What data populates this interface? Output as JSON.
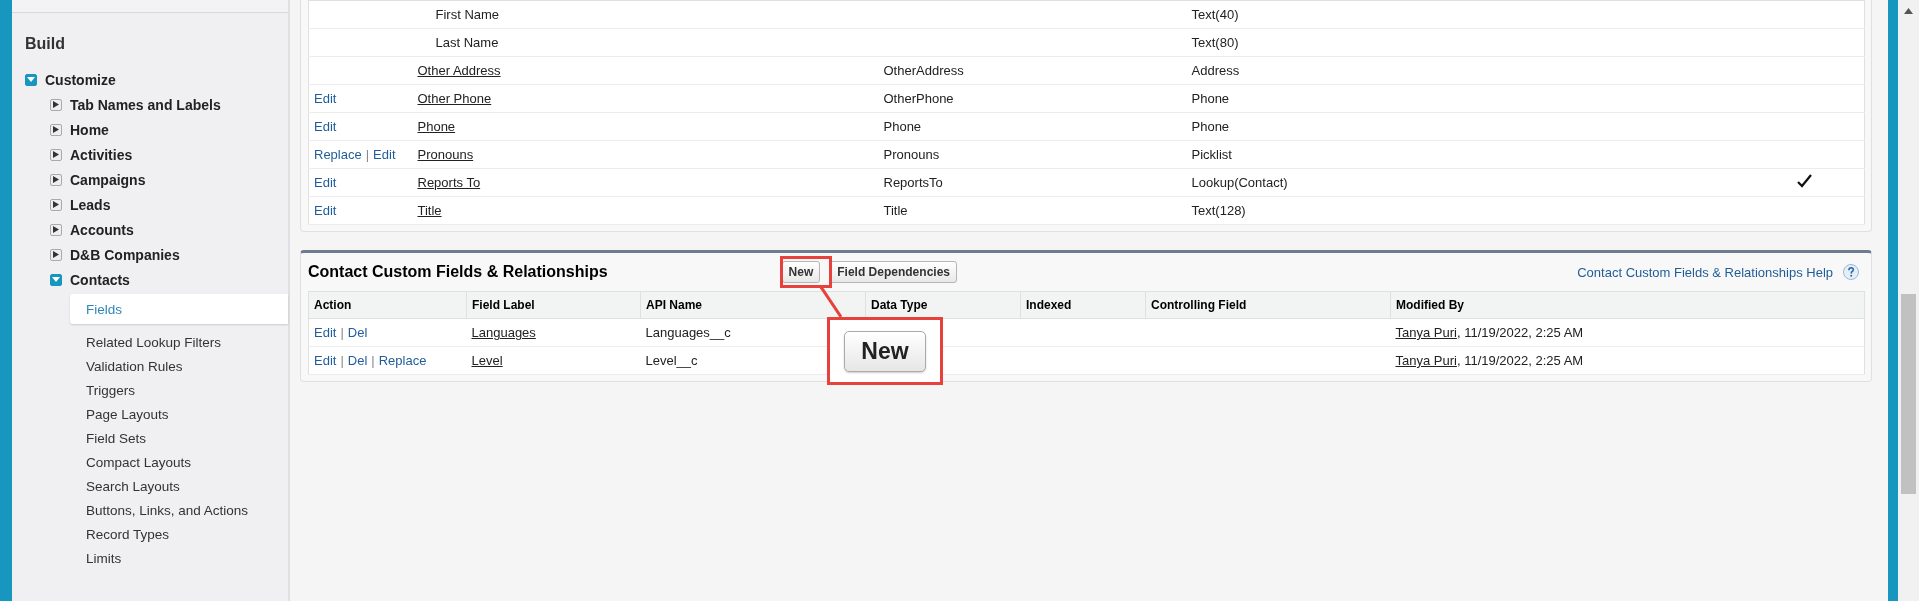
{
  "sidebar": {
    "heading": "Build",
    "root": {
      "label": "Customize",
      "expanded": true,
      "children": [
        {
          "label": "Tab Names and Labels",
          "expanded": false
        },
        {
          "label": "Home",
          "expanded": false
        },
        {
          "label": "Activities",
          "expanded": false
        },
        {
          "label": "Campaigns",
          "expanded": false
        },
        {
          "label": "Leads",
          "expanded": false
        },
        {
          "label": "Accounts",
          "expanded": false
        },
        {
          "label": "D&B Companies",
          "expanded": false
        },
        {
          "label": "Contacts",
          "expanded": true,
          "children": [
            {
              "label": "Fields",
              "selected": true
            },
            {
              "label": "Related Lookup Filters",
              "selected": false
            },
            {
              "label": "Validation Rules",
              "selected": false
            },
            {
              "label": "Triggers",
              "selected": false
            },
            {
              "label": "Page Layouts",
              "selected": false
            },
            {
              "label": "Field Sets",
              "selected": false
            },
            {
              "label": "Compact Layouts",
              "selected": false
            },
            {
              "label": "Search Layouts",
              "selected": false
            },
            {
              "label": "Buttons, Links, and Actions",
              "selected": false
            },
            {
              "label": "Record Types",
              "selected": false
            },
            {
              "label": "Limits",
              "selected": false
            }
          ]
        }
      ]
    }
  },
  "standard_fields": {
    "separator": "|",
    "rows": [
      {
        "kind": "subfield",
        "actions": [],
        "label": "First Name",
        "api_name": "",
        "data_type": "Text(40)",
        "indexed": false
      },
      {
        "kind": "subfield",
        "actions": [],
        "label": "Last Name",
        "api_name": "",
        "data_type": "Text(80)",
        "indexed": false
      },
      {
        "kind": "field",
        "actions": [],
        "label": "Other Address",
        "api_name": "OtherAddress",
        "data_type": "Address",
        "indexed": false
      },
      {
        "kind": "field",
        "actions": [
          "Edit"
        ],
        "label": "Other Phone",
        "api_name": "OtherPhone",
        "data_type": "Phone",
        "indexed": false
      },
      {
        "kind": "field",
        "actions": [
          "Edit"
        ],
        "label": "Phone",
        "api_name": "Phone",
        "data_type": "Phone",
        "indexed": false
      },
      {
        "kind": "field",
        "actions": [
          "Replace",
          "Edit"
        ],
        "label": "Pronouns",
        "api_name": "Pronouns",
        "data_type": "Picklist",
        "indexed": false
      },
      {
        "kind": "field",
        "actions": [
          "Edit"
        ],
        "label": "Reports To",
        "api_name": "ReportsTo",
        "data_type": "Lookup(Contact)",
        "indexed": true
      },
      {
        "kind": "field",
        "actions": [
          "Edit"
        ],
        "label": "Title",
        "api_name": "Title",
        "data_type": "Text(128)",
        "indexed": false
      }
    ]
  },
  "custom_fields": {
    "title": "Contact Custom Fields & Relationships",
    "buttons": [
      "New",
      "Field Dependencies"
    ],
    "help_link": "Contact Custom Fields & Relationships Help",
    "separator": "|",
    "columns": [
      "Action",
      "Field Label",
      "API Name",
      "Data Type",
      "Indexed",
      "Controlling Field",
      "Modified By"
    ],
    "rows": [
      {
        "actions": [
          "Edit",
          "Del"
        ],
        "label": "Languages",
        "api_name": "Languages__c",
        "modified_by": "Tanya Puri",
        "modified_at": ", 11/19/2022, 2:25 AM"
      },
      {
        "actions": [
          "Edit",
          "Del",
          "Replace"
        ],
        "label": "Level",
        "api_name": "Level__c",
        "modified_by": "Tanya Puri",
        "modified_at": ", 11/19/2022, 2:25 AM"
      }
    ]
  },
  "callout": {
    "label": "New"
  }
}
